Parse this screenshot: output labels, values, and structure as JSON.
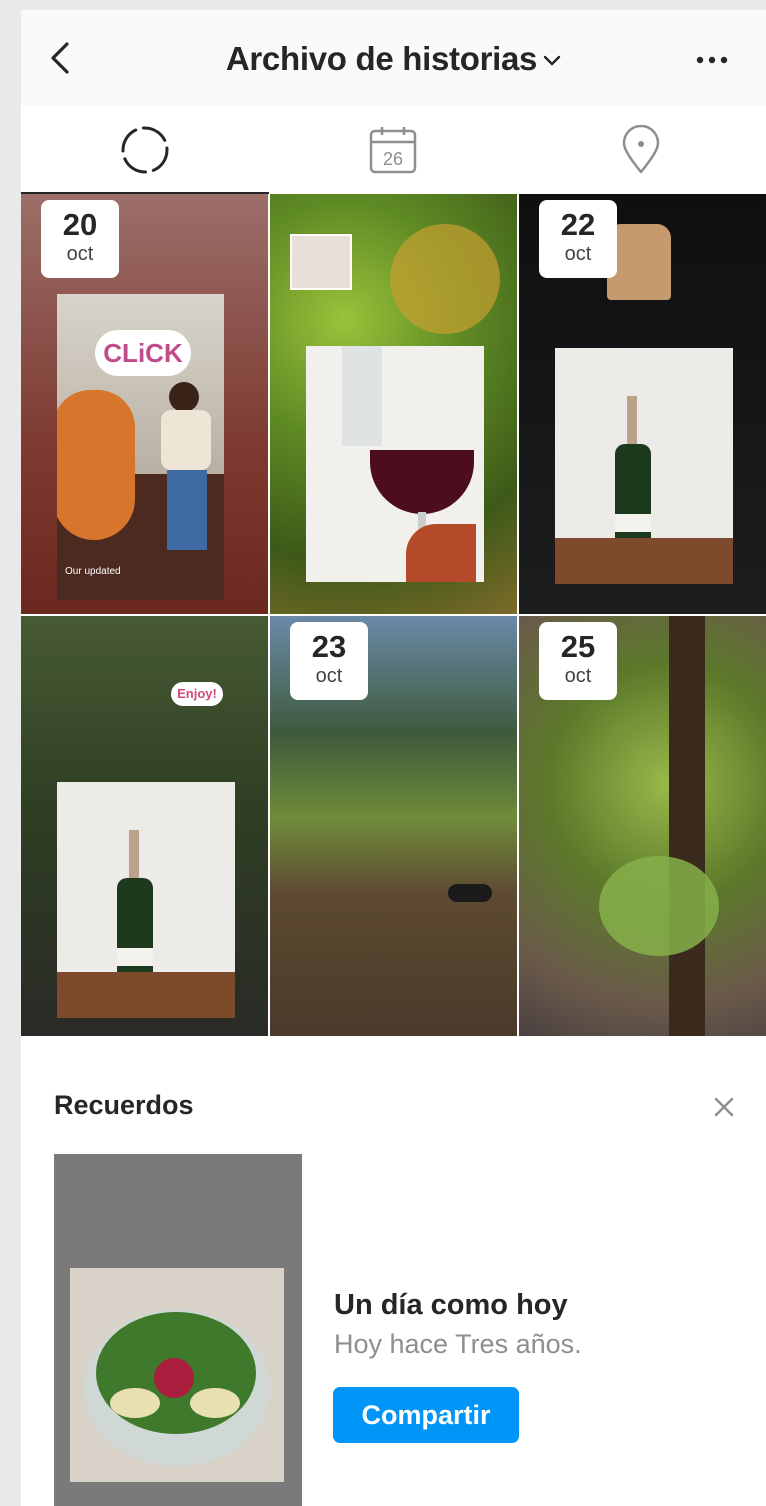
{
  "header": {
    "title": "Archivo de historias"
  },
  "tabs": [
    {
      "name": "stories",
      "icon": "circle-dashed-icon"
    },
    {
      "name": "calendar",
      "icon": "calendar-icon",
      "label": "26"
    },
    {
      "name": "location",
      "icon": "location-pin-icon"
    }
  ],
  "grid": [
    {
      "day": "20",
      "month": "oct",
      "sticker": "CLiCK",
      "caption": "Our updated"
    },
    {
      "day": "",
      "month": ""
    },
    {
      "day": "22",
      "month": "oct"
    },
    {
      "day": "",
      "month": "",
      "sticker": "Enjoy!"
    },
    {
      "day": "23",
      "month": "oct"
    },
    {
      "day": "25",
      "month": "oct"
    }
  ],
  "memories": {
    "title": "Recuerdos",
    "heading": "Un día como hoy",
    "subtitle": "Hoy hace Tres años.",
    "share_label": "Compartir"
  },
  "colors": {
    "accent": "#0095f6",
    "text": "#262626",
    "muted": "#8e8e8e"
  }
}
